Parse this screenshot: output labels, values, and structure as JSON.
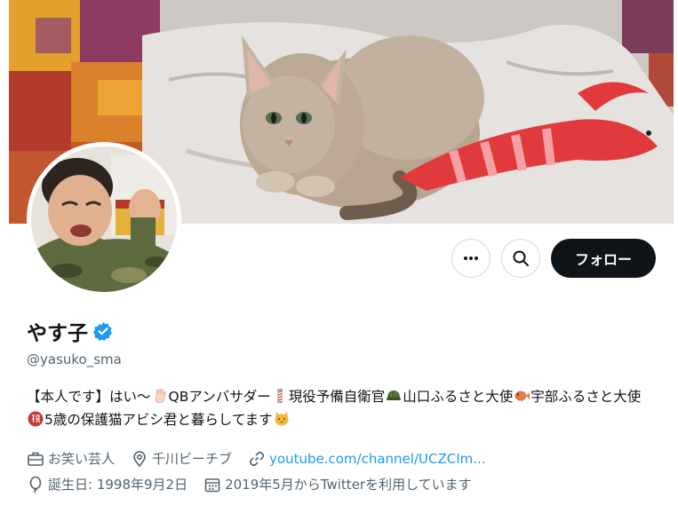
{
  "profile": {
    "display_name": "やす子",
    "handle": "@yasuko_sma",
    "verified": true,
    "bio": {
      "seg1": "【本人です】はい〜",
      "seg2": "QBアンバサダー",
      "seg3": "現役予備自衛官",
      "seg4": "山口ふるさと大使",
      "seg5": "宇部ふるさと大使",
      "seg6": "5歳の保護猫アビシ君と暮らしてます"
    },
    "meta": {
      "profession": "お笑い芸人",
      "location": "千川ビーチブ",
      "url": "youtube.com/channel/UCZCIm...",
      "birthday": "誕生日: 1998年9月2日",
      "joined": "2019年5月からTwitterを利用しています"
    }
  },
  "actions": {
    "follow_label": "フォロー",
    "more_icon": "more-horizontal-icon",
    "search_icon": "search-icon"
  },
  "colors": {
    "accent": "#1d9bf0",
    "text_primary": "#0f1419",
    "text_secondary": "#536471",
    "follow_bg": "#0f1419",
    "verified": "#1d9bf0"
  }
}
